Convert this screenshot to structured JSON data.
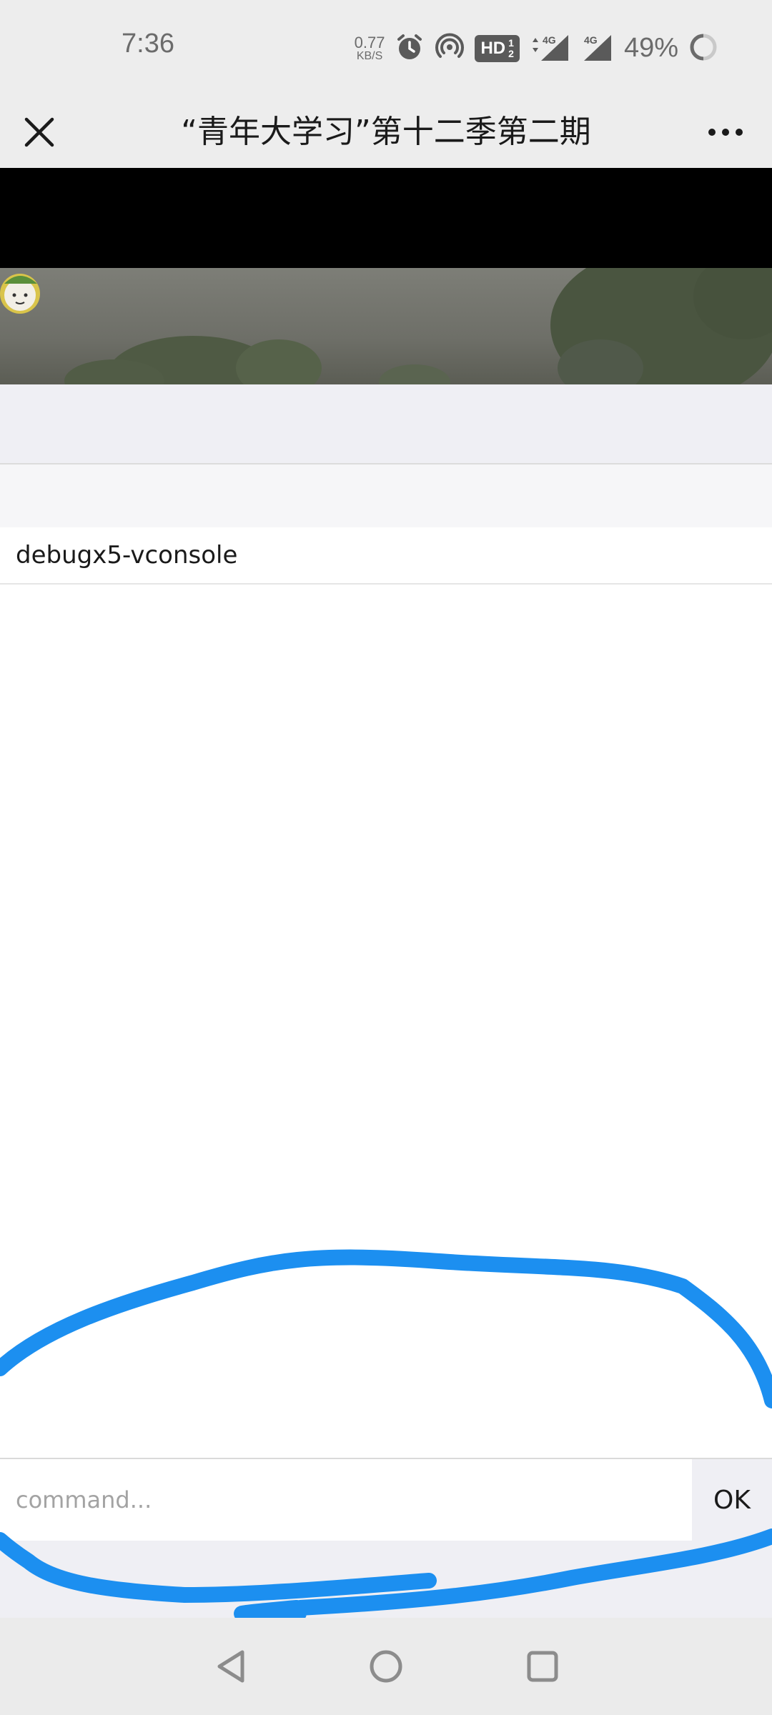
{
  "status_bar": {
    "time": "7:36",
    "net_speed_value": "0.77",
    "net_speed_unit": "KB/S",
    "hd_label": "HD",
    "sim_top": "1",
    "sim_bottom": "2",
    "network_1": "4G",
    "network_2": "4G",
    "battery_percent": "49%",
    "icons": [
      "alarm-icon",
      "hotspot-icon",
      "signal-icon",
      "battery-ring-icon"
    ]
  },
  "title_bar": {
    "title": "“青年大学习”第十二季第二期",
    "close_icon": "close-icon",
    "more_icon": "more-icon"
  },
  "vconsole": {
    "tab_label": "debugx5-vconsole",
    "command_placeholder": "command...",
    "command_value": "",
    "ok_label": "OK"
  },
  "annotation": {
    "stroke_color": "#1c8ff0"
  },
  "nav_bar": {
    "icons": [
      "back-icon",
      "home-icon",
      "recents-icon"
    ]
  }
}
